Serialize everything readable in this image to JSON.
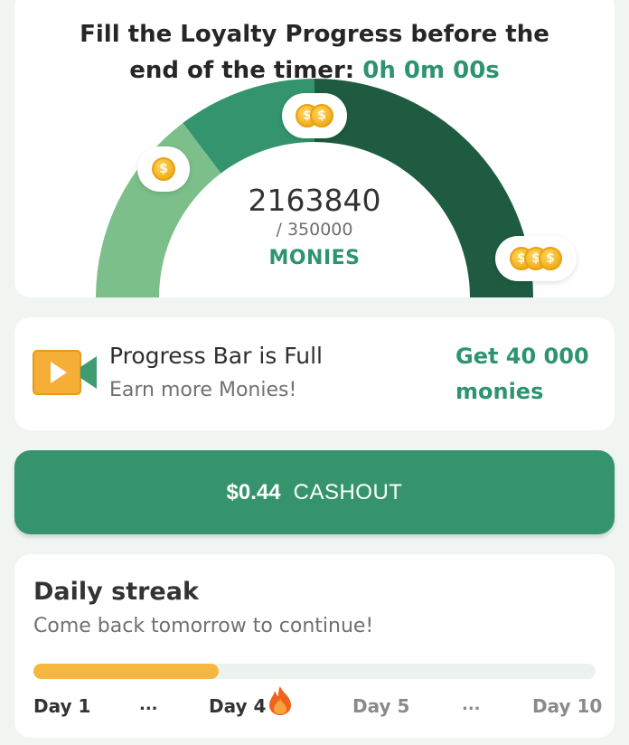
{
  "header": {
    "line1": "Fill the Loyalty Progress before the",
    "line2": "end of the timer:",
    "timer": "0h 0m 00s"
  },
  "gauge": {
    "value": "2163840",
    "target": "/ 350000",
    "unit": "MONIES",
    "colors": {
      "low": "#7cbf8b",
      "mid": "#33946d",
      "high": "#1e5b41"
    },
    "badges": [
      {
        "name": "one-coin",
        "icon": "coin-icon",
        "count": 1
      },
      {
        "name": "two-coins",
        "icon": "coin-icon",
        "count": 2
      },
      {
        "name": "three-coins",
        "icon": "coin-icon",
        "count": 3
      }
    ],
    "coin_symbol": "$"
  },
  "progress_card": {
    "title": "Progress Bar is Full",
    "subtitle": "Earn more Monies!",
    "reward_line1": "Get 40 000",
    "reward_line2": "monies",
    "icon": "video-camera-icon"
  },
  "cashout": {
    "amount": "$0.44",
    "label": "CASHOUT",
    "color": "#35946e"
  },
  "streak": {
    "title": "Daily streak",
    "subtitle": "Come back tomorrow to continue!",
    "progress": 0.33,
    "fill_color": "#f6b740",
    "days": {
      "first": "Day 1",
      "current": "Day 4",
      "next": "Day 5",
      "last": "Day 10",
      "ellipsis": "..."
    },
    "current_icon": "flame-icon"
  }
}
